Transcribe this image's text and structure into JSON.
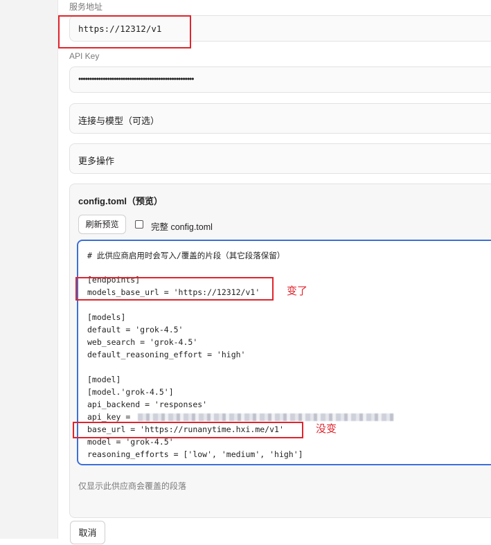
{
  "service_url": {
    "label": "服务地址",
    "value": "https://12312/v1"
  },
  "api_key": {
    "label": "API Key",
    "value": "••••••••••••••••••••••••••••••••••••••••••••••••••••"
  },
  "sections": {
    "connection": "连接与模型（可选）",
    "more_actions": "更多操作"
  },
  "config_panel": {
    "title": "config.toml（预览）",
    "refresh_button": "刷新预览",
    "full_checkbox_label": "完整 config.toml",
    "full_checked": false,
    "code_lines": [
      "# 此供应商启用时会写入/覆盖的片段（其它段落保留）",
      "",
      "[endpoints]",
      "models_base_url = 'https://12312/v1'",
      "",
      "[models]",
      "default = 'grok-4.5'",
      "web_search = 'grok-4.5'",
      "default_reasoning_effort = 'high'",
      "",
      "[model]",
      "[model.'grok-4.5']",
      "api_backend = 'responses'",
      "api_key = ",
      "base_url = 'https://runanytime.hxi.me/v1'",
      "model = 'grok-4.5'",
      "reasoning_efforts = ['low', 'medium', 'high']"
    ],
    "hint": "仅显示此供应商会覆盖的段落"
  },
  "annotations": {
    "changed": "变了",
    "unchanged": "没变"
  },
  "footer": {
    "cancel_button": "取消"
  },
  "colors": {
    "annotation_red": "#e0242c",
    "editor_focus_blue": "#3a6fd8"
  }
}
